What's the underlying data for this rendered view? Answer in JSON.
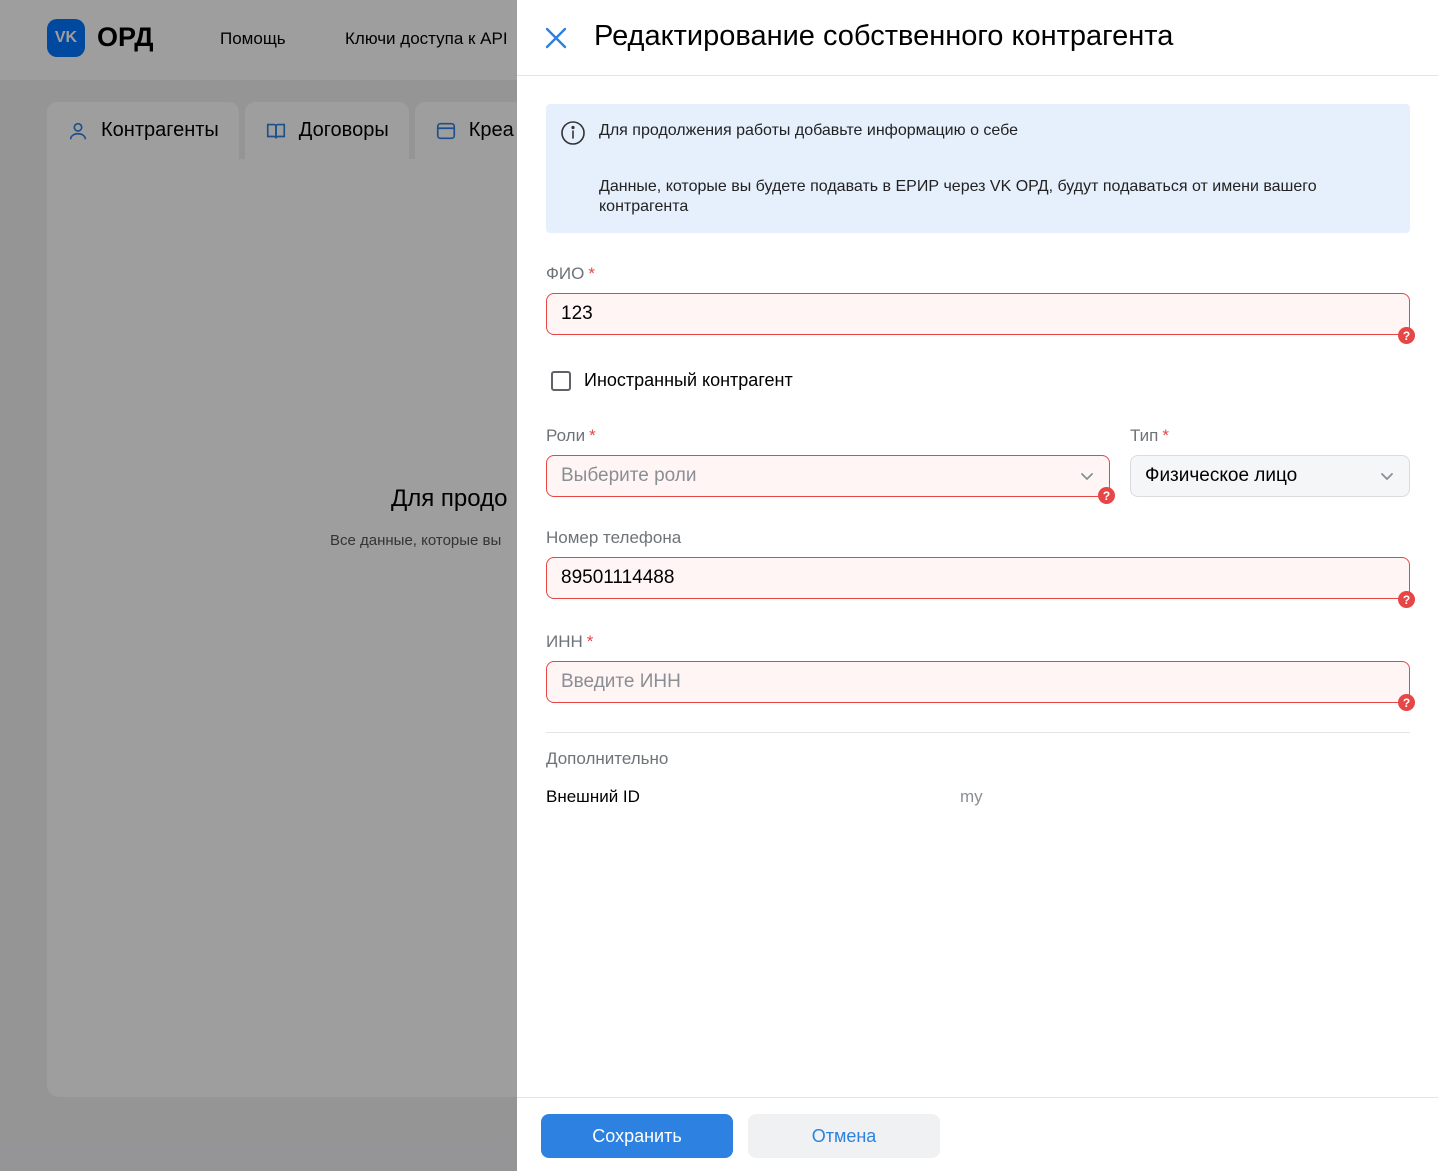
{
  "app": {
    "logo_text": "VK",
    "brand": "ОРД",
    "nav": [
      "Помощь",
      "Ключи доступа к API"
    ],
    "tabs": [
      {
        "label": "Контрагенты",
        "icon": "user-icon"
      },
      {
        "label": "Договоры",
        "icon": "book-icon"
      },
      {
        "label": "Креа",
        "icon": "creative-icon"
      }
    ],
    "empty_title": "Для продо",
    "empty_subtitle": "Все данные, которые вы"
  },
  "drawer": {
    "title": "Редактирование собственного контрагента",
    "info": {
      "line1": "Для продолжения работы добавьте информацию о себе",
      "line2": "Данные, которые вы будете подавать в ЕРИР через VK ОРД, будут подаваться от имени вашего контрагента"
    },
    "fio": {
      "label": "ФИО",
      "required_mark": "*",
      "value": "123"
    },
    "foreign": {
      "label": "Иностранный контрагент",
      "checked": false
    },
    "roles": {
      "label": "Роли",
      "required_mark": "*",
      "placeholder": "Выберите роли"
    },
    "type": {
      "label": "Тип",
      "required_mark": "*",
      "value": "Физическое лицо"
    },
    "phone": {
      "label": "Номер телефона",
      "value": "89501114488"
    },
    "inn": {
      "label": "ИНН",
      "required_mark": "*",
      "placeholder": "Введите ИНН"
    },
    "extra": {
      "title": "Дополнительно",
      "external_id_label": "Внешний ID",
      "external_id_value": "my"
    },
    "error_badge": "?",
    "buttons": {
      "save": "Сохранить",
      "cancel": "Отмена"
    }
  },
  "colors": {
    "accent": "#2d81e0",
    "error": "#e64646",
    "info_bg": "#e6f0fc"
  }
}
